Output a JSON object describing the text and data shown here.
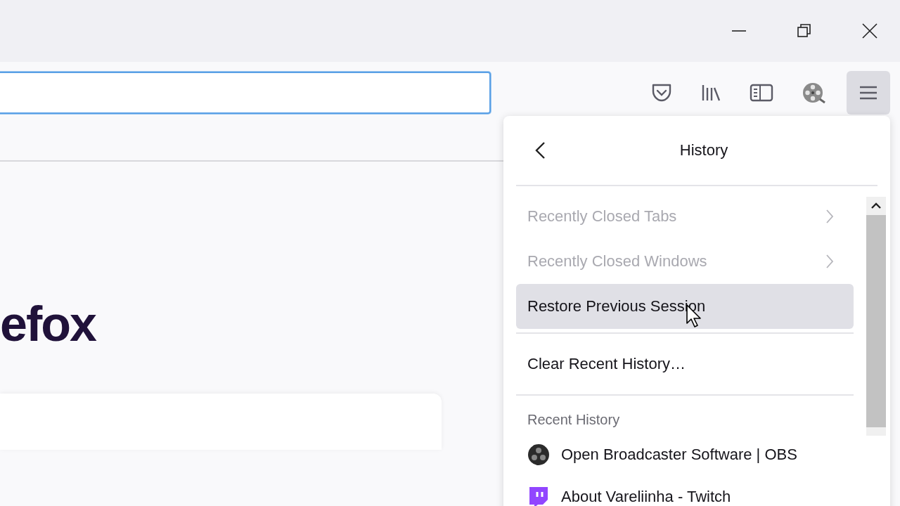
{
  "toolbar": {
    "address_field": {
      "focused": true
    },
    "menu_button": {
      "expanded": true
    }
  },
  "page": {
    "logo_text": "efox"
  },
  "menu": {
    "title": "History",
    "items": [
      {
        "kind": "submenu",
        "label": "Recently Closed Tabs",
        "disabled": true,
        "highlighted": false
      },
      {
        "kind": "submenu",
        "label": "Recently Closed Windows",
        "disabled": true,
        "highlighted": false
      },
      {
        "kind": "action",
        "label": "Restore Previous Session",
        "disabled": false,
        "highlighted": true
      },
      {
        "kind": "separator"
      },
      {
        "kind": "action",
        "label": "Clear Recent History…",
        "disabled": false,
        "highlighted": false
      },
      {
        "kind": "separator"
      }
    ],
    "recent_history": {
      "title": "Recent History",
      "entries": [
        {
          "kind": "circle",
          "label": "Open Broadcaster Software | OBS"
        },
        {
          "kind": "speech",
          "label": "About Vareliinha - Twitch"
        }
      ]
    }
  }
}
